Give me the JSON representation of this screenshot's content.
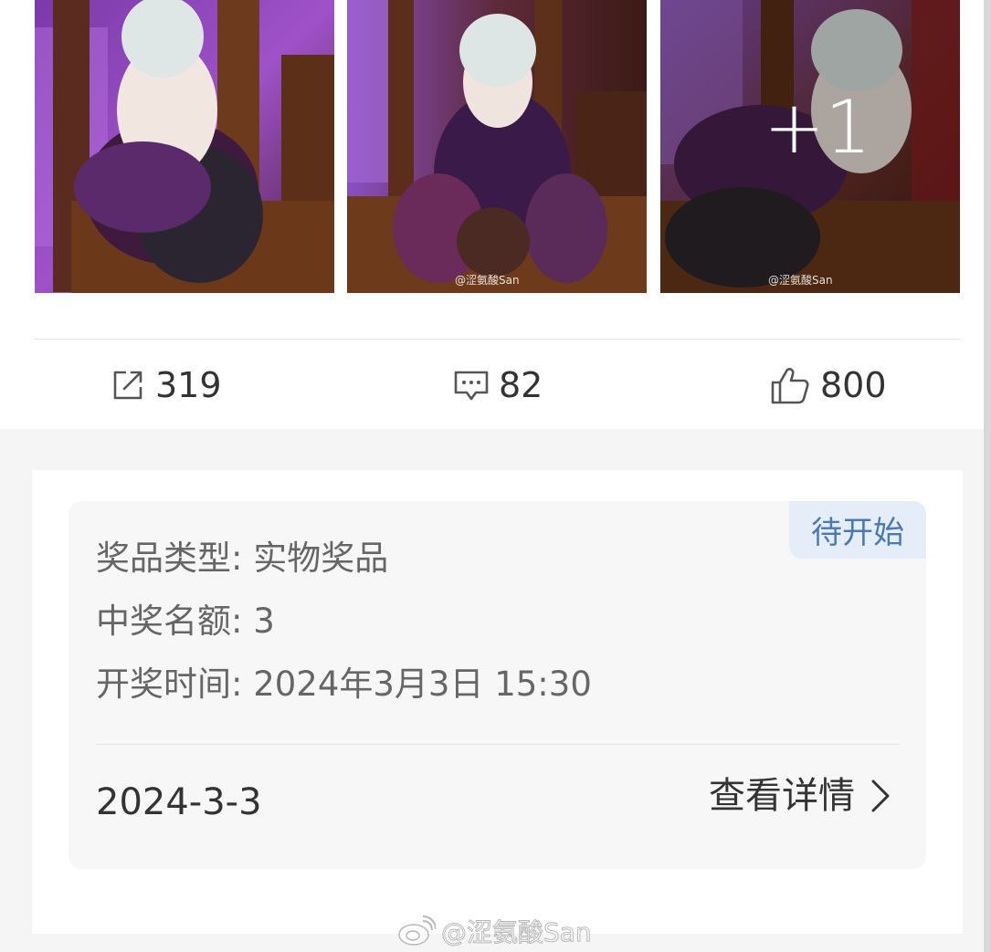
{
  "gallery": {
    "images": [
      {
        "icon": "photo-cosplay-bunny-bar-1",
        "watermark": ""
      },
      {
        "icon": "photo-cosplay-bunny-bar-2",
        "watermark": "@涩氨酸San"
      },
      {
        "icon": "photo-cosplay-bunny-bar-3",
        "watermark": "@涩氨酸San"
      }
    ],
    "more_count": "+1"
  },
  "actions": {
    "share": {
      "icon": "share-icon",
      "count": "319"
    },
    "comment": {
      "icon": "comment-icon",
      "count": "82"
    },
    "like": {
      "icon": "thumbs-up-icon",
      "count": "800"
    }
  },
  "lottery": {
    "status": "待开始",
    "prize_type": "奖品类型: 实物奖品",
    "winner_count": "中奖名额: 3",
    "draw_time": "开奖时间: 2024年3月3日 15:30",
    "date": "2024-3-3",
    "details_label": "查看详情",
    "details_icon": "chevron-right-icon"
  },
  "footer": {
    "watermark": "@涩氨酸San",
    "icon": "weibo-logo-icon"
  },
  "colors": {
    "status_text": "#4a79b3",
    "status_bg": "#e5eef8",
    "card_bg": "#f7f7f7",
    "page_bg": "#f5f5f5"
  }
}
